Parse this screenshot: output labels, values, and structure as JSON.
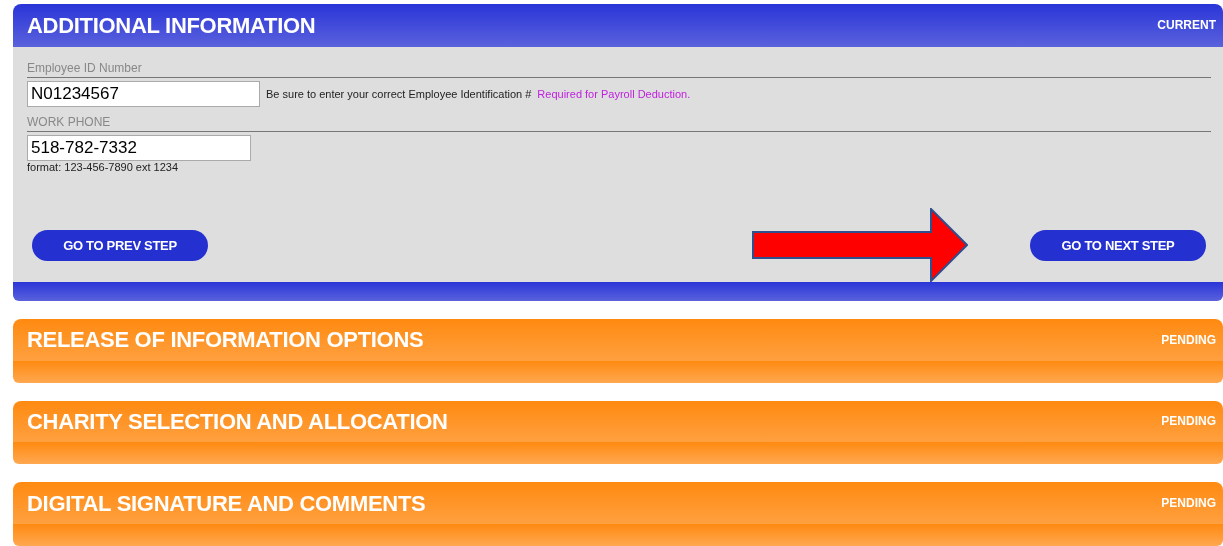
{
  "sections": [
    {
      "title": "ADDITIONAL INFORMATION",
      "status": "CURRENT",
      "kind": "current",
      "fields": [
        {
          "label": "Employee ID Number",
          "value": "N01234567",
          "hint": "Be sure to enter your correct Employee Identification #",
          "note": "Required for Payroll Deduction."
        },
        {
          "label": "WORK PHONE",
          "value": "518-782-7332",
          "format": "format: 123-456-7890 ext 1234"
        }
      ],
      "buttons": [
        "GO TO PREV STEP",
        "GO TO NEXT STEP"
      ]
    },
    {
      "title": "RELEASE OF INFORMATION OPTIONS",
      "status": "PENDING",
      "kind": "pending"
    },
    {
      "title": "CHARITY SELECTION AND ALLOCATION",
      "status": "PENDING",
      "kind": "pending"
    },
    {
      "title": "DIGITAL SIGNATURE AND COMMENTS",
      "status": "PENDING",
      "kind": "pending"
    }
  ]
}
